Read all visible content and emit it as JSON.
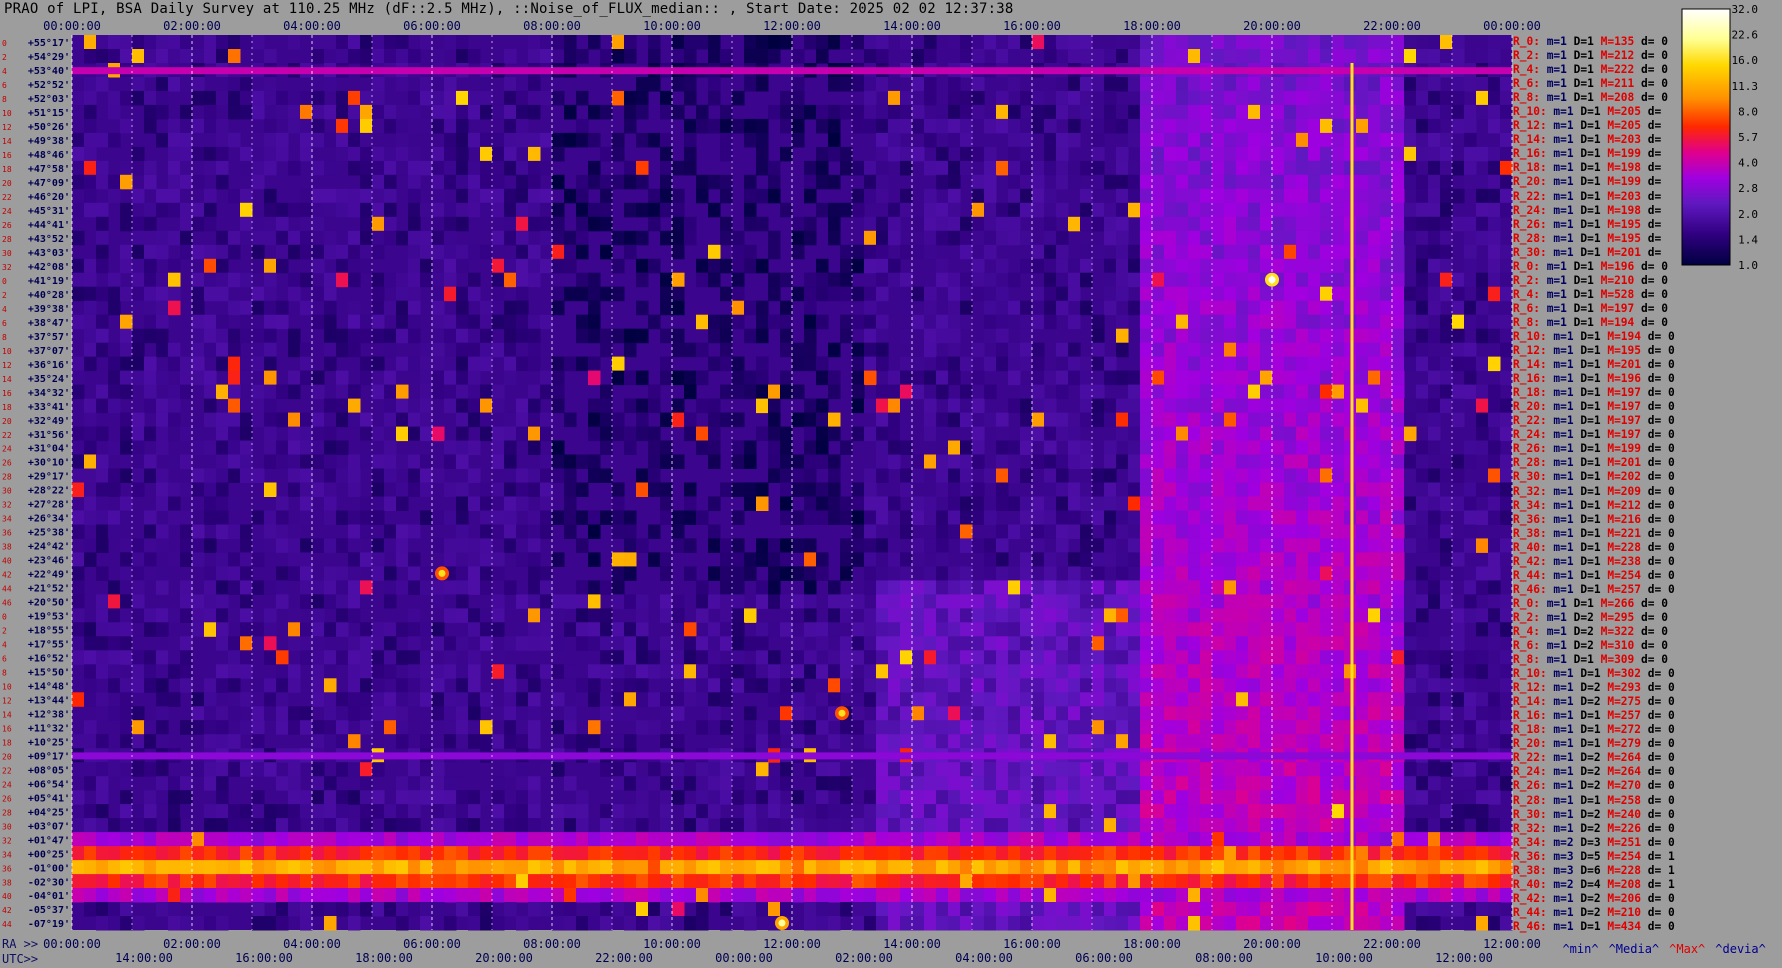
{
  "title": "PRAO of LPI, BSA Daily Survey at 110.25 MHz (dF::2.5 MHz), ::Noise_of_FLUX_median:: , Start Date: 2025 02 02 12:37:38",
  "chart_data": {
    "type": "heatmap",
    "title": "PRAO of LPI, BSA Daily Survey at 110.25 MHz (dF::2.5 MHz), ::Noise_of_FLUX_median:: , Start Date: 2025 02 02 12:37:38",
    "x_top_ticks": [
      "00:00:00",
      "02:00:00",
      "04:00:00",
      "06:00:00",
      "08:00:00",
      "10:00:00",
      "12:00:00",
      "14:00:00",
      "16:00:00",
      "18:00:00",
      "20:00:00",
      "22:00:00",
      "00:00:00"
    ],
    "x_bottom_ra_ticks": [
      "00:00:00",
      "02:00:00",
      "04:00:00",
      "06:00:00",
      "08:00:00",
      "10:00:00",
      "12:00:00",
      "14:00:00",
      "16:00:00",
      "18:00:00",
      "20:00:00",
      "22:00:00",
      "12:00:00"
    ],
    "x_bottom_utc_ticks": [
      "14:00:00",
      "16:00:00",
      "18:00:00",
      "20:00:00",
      "22:00:00",
      "00:00:00",
      "02:00:00",
      "04:00:00",
      "06:00:00",
      "08:00:00",
      "10:00:00",
      "12:00:00"
    ],
    "y_ticks": [
      "+55°17'",
      "+54°29'",
      "+53°40'",
      "+52°52'",
      "+52°03'",
      "+51°15'",
      "+50°26'",
      "+49°38'",
      "+48°46'",
      "+47°58'",
      "+47°09'",
      "+46°20'",
      "+45°31'",
      "+44°41'",
      "+43°52'",
      "+43°03'",
      "+42°08'",
      "+41°19'",
      "+40°28'",
      "+39°38'",
      "+38°47'",
      "+37°57'",
      "+37°07'",
      "+36°16'",
      "+35°24'",
      "+34°32'",
      "+33°41'",
      "+32°49'",
      "+31°56'",
      "+31°04'",
      "+30°10'",
      "+29°17'",
      "+28°22'",
      "+27°28'",
      "+26°34'",
      "+25°38'",
      "+24°42'",
      "+23°46'",
      "+22°49'",
      "+21°52'",
      "+20°50'",
      "+19°53'",
      "+18°55'",
      "+17°55'",
      "+16°52'",
      "+15°50'",
      "+14°48'",
      "+13°44'",
      "+12°38'",
      "+11°32'",
      "+10°25'",
      "+09°17'",
      "+08°05'",
      "+06°54'",
      "+05°41'",
      "+04°25'",
      "+03°07'",
      "+01°47'",
      "+00°25'",
      "-01°00'",
      "-02°30'",
      "-04°01'",
      "-05°37'",
      "-07°19'"
    ],
    "y_index": [
      "0",
      "2",
      "4",
      "6",
      "8",
      "10",
      "12",
      "14",
      "16",
      "18",
      "20",
      "22",
      "24",
      "26",
      "28",
      "30",
      "32",
      "0",
      "2",
      "4",
      "6",
      "8",
      "10",
      "12",
      "14",
      "16",
      "18",
      "20",
      "22",
      "24",
      "26",
      "28",
      "30",
      "32",
      "34",
      "36",
      "38",
      "40",
      "42",
      "44",
      "46",
      "0",
      "2",
      "4",
      "6",
      "8",
      "10",
      "12",
      "14",
      "16",
      "18",
      "20",
      "22",
      "24",
      "26",
      "28",
      "30",
      "32",
      "34",
      "36",
      "38",
      "40",
      "42",
      "44"
    ],
    "colorbar": {
      "ticks": [
        "32.0",
        "22.6",
        "16.0",
        "11.3",
        "8.0",
        "5.7",
        "4.0",
        "2.8",
        "2.0",
        "1.4",
        "1.0"
      ],
      "scale": "log",
      "range": [
        1.0,
        32.0
      ],
      "colors": [
        "#ffffff",
        "#ffff90",
        "#ffd800",
        "#ff9000",
        "#ff2800",
        "#e0008c",
        "#a000e0",
        "#6018c0",
        "#300080",
        "#000040"
      ]
    },
    "features": [
      {
        "kind": "horizontal-band",
        "dec": "-01°00'",
        "level": 11.3
      },
      {
        "kind": "horizontal-line",
        "dec": "+53°40'",
        "level": 4.0
      },
      {
        "kind": "horizontal-line",
        "dec": "+09°17'",
        "level": 2.8
      },
      {
        "kind": "vertical-line",
        "time": "21:20:00",
        "level": 16.0
      },
      {
        "kind": "point-source",
        "time": "20:00:00",
        "dec": "+41°19'",
        "level": 32.0
      },
      {
        "kind": "point-source",
        "time": "11:50:00",
        "dec": "-07°19'",
        "level": 22.6
      },
      {
        "kind": "point-source",
        "time": "06:10:00",
        "dec": "+22°49'",
        "level": 16.0
      },
      {
        "kind": "point-source",
        "time": "12:50:00",
        "dec": "+12°38'",
        "level": 16.0
      }
    ]
  },
  "right_panel": {
    "rows": [
      {
        "label": "R_0:",
        "m": "m=1",
        "D": "D=1",
        "M": "M=135",
        "d": "d= 0"
      },
      {
        "label": "R_2:",
        "m": "m=1",
        "D": "D=1",
        "M": "M=212",
        "d": "d= 0"
      },
      {
        "label": "R_4:",
        "m": "m=1",
        "D": "D=1",
        "M": "M=222",
        "d": "d= 0"
      },
      {
        "label": "R_6:",
        "m": "m=1",
        "D": "D=1",
        "M": "M=211",
        "d": "d= 0"
      },
      {
        "label": "R_8:",
        "m": "m=1",
        "D": "D=1",
        "M": "M=208",
        "d": "d= 0"
      },
      {
        "label": "R_10:",
        "m": "m=1",
        "D": "D=1",
        "M": "M=205",
        "d": "d="
      },
      {
        "label": "R_12:",
        "m": "m=1",
        "D": "D=1",
        "M": "M=205",
        "d": "d="
      },
      {
        "label": "R_14:",
        "m": "m=1",
        "D": "D=1",
        "M": "M=203",
        "d": "d="
      },
      {
        "label": "R_16:",
        "m": "m=1",
        "D": "D=1",
        "M": "M=199",
        "d": "d="
      },
      {
        "label": "R_18:",
        "m": "m=1",
        "D": "D=1",
        "M": "M=198",
        "d": "d="
      },
      {
        "label": "R_20:",
        "m": "m=1",
        "D": "D=1",
        "M": "M=199",
        "d": "d="
      },
      {
        "label": "R_22:",
        "m": "m=1",
        "D": "D=1",
        "M": "M=203",
        "d": "d="
      },
      {
        "label": "R_24:",
        "m": "m=1",
        "D": "D=1",
        "M": "M=198",
        "d": "d="
      },
      {
        "label": "R_26:",
        "m": "m=1",
        "D": "D=1",
        "M": "M=195",
        "d": "d="
      },
      {
        "label": "R_28:",
        "m": "m=1",
        "D": "D=1",
        "M": "M=195",
        "d": "d="
      },
      {
        "label": "R_30:",
        "m": "m=1",
        "D": "D=1",
        "M": "M=201",
        "d": "d="
      },
      {
        "label": "R_0:",
        "m": "m=1",
        "D": "D=1",
        "M": "M=196",
        "d": "d= 0"
      },
      {
        "label": "R_2:",
        "m": "m=1",
        "D": "D=1",
        "M": "M=210",
        "d": "d= 0"
      },
      {
        "label": "R_4:",
        "m": "m=1",
        "D": "D=1",
        "M": "M=528",
        "d": "d= 0"
      },
      {
        "label": "R_6:",
        "m": "m=1",
        "D": "D=1",
        "M": "M=197",
        "d": "d= 0"
      },
      {
        "label": "R_8:",
        "m": "m=1",
        "D": "D=1",
        "M": "M=194",
        "d": "d= 0"
      },
      {
        "label": "R_10:",
        "m": "m=1",
        "D": "D=1",
        "M": "M=194",
        "d": "d= 0"
      },
      {
        "label": "R_12:",
        "m": "m=1",
        "D": "D=1",
        "M": "M=195",
        "d": "d= 0"
      },
      {
        "label": "R_14:",
        "m": "m=1",
        "D": "D=1",
        "M": "M=201",
        "d": "d= 0"
      },
      {
        "label": "R_16:",
        "m": "m=1",
        "D": "D=1",
        "M": "M=196",
        "d": "d= 0"
      },
      {
        "label": "R_18:",
        "m": "m=1",
        "D": "D=1",
        "M": "M=197",
        "d": "d= 0"
      },
      {
        "label": "R_20:",
        "m": "m=1",
        "D": "D=1",
        "M": "M=197",
        "d": "d= 0"
      },
      {
        "label": "R_22:",
        "m": "m=1",
        "D": "D=1",
        "M": "M=197",
        "d": "d= 0"
      },
      {
        "label": "R_24:",
        "m": "m=1",
        "D": "D=1",
        "M": "M=197",
        "d": "d= 0"
      },
      {
        "label": "R_26:",
        "m": "m=1",
        "D": "D=1",
        "M": "M=199",
        "d": "d= 0"
      },
      {
        "label": "R_28:",
        "m": "m=1",
        "D": "D=1",
        "M": "M=201",
        "d": "d= 0"
      },
      {
        "label": "R_30:",
        "m": "m=1",
        "D": "D=1",
        "M": "M=202",
        "d": "d= 0"
      },
      {
        "label": "R_32:",
        "m": "m=1",
        "D": "D=1",
        "M": "M=209",
        "d": "d= 0"
      },
      {
        "label": "R_34:",
        "m": "m=1",
        "D": "D=1",
        "M": "M=212",
        "d": "d= 0"
      },
      {
        "label": "R_36:",
        "m": "m=1",
        "D": "D=1",
        "M": "M=216",
        "d": "d= 0"
      },
      {
        "label": "R_38:",
        "m": "m=1",
        "D": "D=1",
        "M": "M=221",
        "d": "d= 0"
      },
      {
        "label": "R_40:",
        "m": "m=1",
        "D": "D=1",
        "M": "M=228",
        "d": "d= 0"
      },
      {
        "label": "R_42:",
        "m": "m=1",
        "D": "D=1",
        "M": "M=238",
        "d": "d= 0"
      },
      {
        "label": "R_44:",
        "m": "m=1",
        "D": "D=1",
        "M": "M=254",
        "d": "d= 0"
      },
      {
        "label": "R_46:",
        "m": "m=1",
        "D": "D=1",
        "M": "M=257",
        "d": "d= 0"
      },
      {
        "label": "R_0:",
        "m": "m=1",
        "D": "D=1",
        "M": "M=266",
        "d": "d= 0"
      },
      {
        "label": "R_2:",
        "m": "m=1",
        "D": "D=2",
        "M": "M=295",
        "d": "d= 0"
      },
      {
        "label": "R_4:",
        "m": "m=1",
        "D": "D=2",
        "M": "M=322",
        "d": "d= 0"
      },
      {
        "label": "R_6:",
        "m": "m=1",
        "D": "D=2",
        "M": "M=310",
        "d": "d= 0"
      },
      {
        "label": "R_8:",
        "m": "m=1",
        "D": "D=1",
        "M": "M=309",
        "d": "d= 0"
      },
      {
        "label": "R_10:",
        "m": "m=1",
        "D": "D=1",
        "M": "M=302",
        "d": "d= 0"
      },
      {
        "label": "R_12:",
        "m": "m=1",
        "D": "D=2",
        "M": "M=293",
        "d": "d= 0"
      },
      {
        "label": "R_14:",
        "m": "m=1",
        "D": "D=2",
        "M": "M=275",
        "d": "d= 0"
      },
      {
        "label": "R_16:",
        "m": "m=1",
        "D": "D=1",
        "M": "M=257",
        "d": "d= 0"
      },
      {
        "label": "R_18:",
        "m": "m=1",
        "D": "D=1",
        "M": "M=272",
        "d": "d= 0"
      },
      {
        "label": "R_20:",
        "m": "m=1",
        "D": "D=1",
        "M": "M=279",
        "d": "d= 0"
      },
      {
        "label": "R_22:",
        "m": "m=1",
        "D": "D=2",
        "M": "M=264",
        "d": "d= 0"
      },
      {
        "label": "R_24:",
        "m": "m=1",
        "D": "D=2",
        "M": "M=264",
        "d": "d= 0"
      },
      {
        "label": "R_26:",
        "m": "m=1",
        "D": "D=2",
        "M": "M=270",
        "d": "d= 0"
      },
      {
        "label": "R_28:",
        "m": "m=1",
        "D": "D=1",
        "M": "M=258",
        "d": "d= 0"
      },
      {
        "label": "R_30:",
        "m": "m=1",
        "D": "D=2",
        "M": "M=240",
        "d": "d= 0"
      },
      {
        "label": "R_32:",
        "m": "m=1",
        "D": "D=2",
        "M": "M=226",
        "d": "d= 0"
      },
      {
        "label": "R_34:",
        "m": "m=2",
        "D": "D=3",
        "M": "M=251",
        "d": "d= 0"
      },
      {
        "label": "R_36:",
        "m": "m=3",
        "D": "D=5",
        "M": "M=254",
        "d": "d= 1"
      },
      {
        "label": "R_38:",
        "m": "m=3",
        "D": "D=6",
        "M": "M=228",
        "d": "d= 1"
      },
      {
        "label": "R_40:",
        "m": "m=2",
        "D": "D=4",
        "M": "M=208",
        "d": "d= 1"
      },
      {
        "label": "R_42:",
        "m": "m=1",
        "D": "D=2",
        "M": "M=206",
        "d": "d= 0"
      },
      {
        "label": "R_44:",
        "m": "m=1",
        "D": "D=2",
        "M": "M=210",
        "d": "d= 0"
      },
      {
        "label": "R_46:",
        "m": "m=1",
        "D": "D=1",
        "M": "M=434",
        "d": "d= 0"
      }
    ]
  },
  "legend": {
    "min": "^min^",
    "median": "^Media^",
    "max": "^Max^",
    "devia": "^devia^"
  },
  "ra_label": "RA >>",
  "utc_label": "UTC>>"
}
